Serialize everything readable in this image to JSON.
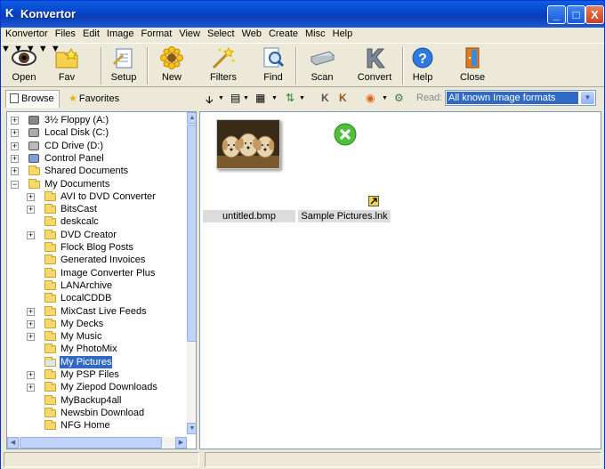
{
  "window": {
    "title": "Konvertor",
    "minimize": "_",
    "maximize": "□",
    "close": "X"
  },
  "menu": [
    "Konvertor",
    "Files",
    "Edit",
    "Image",
    "Format",
    "View",
    "Select",
    "Web",
    "Create",
    "Misc",
    "Help"
  ],
  "toolbar": {
    "open": "Open",
    "fav": "Fav",
    "setup": "Setup",
    "new": "New",
    "filters": "Filters",
    "find": "Find",
    "scan": "Scan",
    "convert": "Convert",
    "help": "Help",
    "close": "Close"
  },
  "tabs": {
    "browse": "Browse",
    "favorites": "Favorites"
  },
  "read": {
    "label": "Read:",
    "value": "All known Image formats"
  },
  "tree": [
    {
      "label": "3½ Floppy (A:)",
      "icon": "floppy-icon"
    },
    {
      "label": "Local Disk (C:)",
      "icon": "hard-disk-icon"
    },
    {
      "label": "CD Drive (D:)",
      "icon": "cd-drive-icon"
    },
    {
      "label": "Control Panel",
      "icon": "control-panel-icon"
    },
    {
      "label": "Shared Documents",
      "icon": "folder-icon"
    },
    {
      "label": "My Documents",
      "icon": "folder-open-icon"
    },
    {
      "label": "AVI to DVD Converter",
      "icon": "folder-icon"
    },
    {
      "label": "BitsCast",
      "icon": "folder-icon"
    },
    {
      "label": "deskcalc",
      "icon": "folder-icon"
    },
    {
      "label": "DVD Creator",
      "icon": "folder-icon"
    },
    {
      "label": "Flock Blog Posts",
      "icon": "folder-icon"
    },
    {
      "label": "Generated Invoices",
      "icon": "folder-icon"
    },
    {
      "label": "Image Converter Plus",
      "icon": "folder-icon"
    },
    {
      "label": "LANArchive",
      "icon": "folder-icon"
    },
    {
      "label": "LocalCDDB",
      "icon": "folder-icon"
    },
    {
      "label": "MixCast Live Feeds",
      "icon": "folder-icon"
    },
    {
      "label": "My Decks",
      "icon": "folder-icon"
    },
    {
      "label": "My Music",
      "icon": "music-folder-icon"
    },
    {
      "label": "My PhotoMix",
      "icon": "folder-icon"
    },
    {
      "label": "My Pictures",
      "icon": "pictures-folder-icon"
    },
    {
      "label": "My PSP Files",
      "icon": "folder-icon"
    },
    {
      "label": "My Ziepod Downloads",
      "icon": "folder-icon"
    },
    {
      "label": "MyBackup4all",
      "icon": "folder-icon"
    },
    {
      "label": "Newsbin Download",
      "icon": "folder-icon"
    },
    {
      "label": "NFG Home",
      "icon": "folder-icon"
    }
  ],
  "files": [
    {
      "name": "untitled.bmp",
      "icon": "puppies-thumbnail"
    },
    {
      "name": "Sample Pictures.lnk",
      "icon": "shortcut-error-icon"
    }
  ]
}
